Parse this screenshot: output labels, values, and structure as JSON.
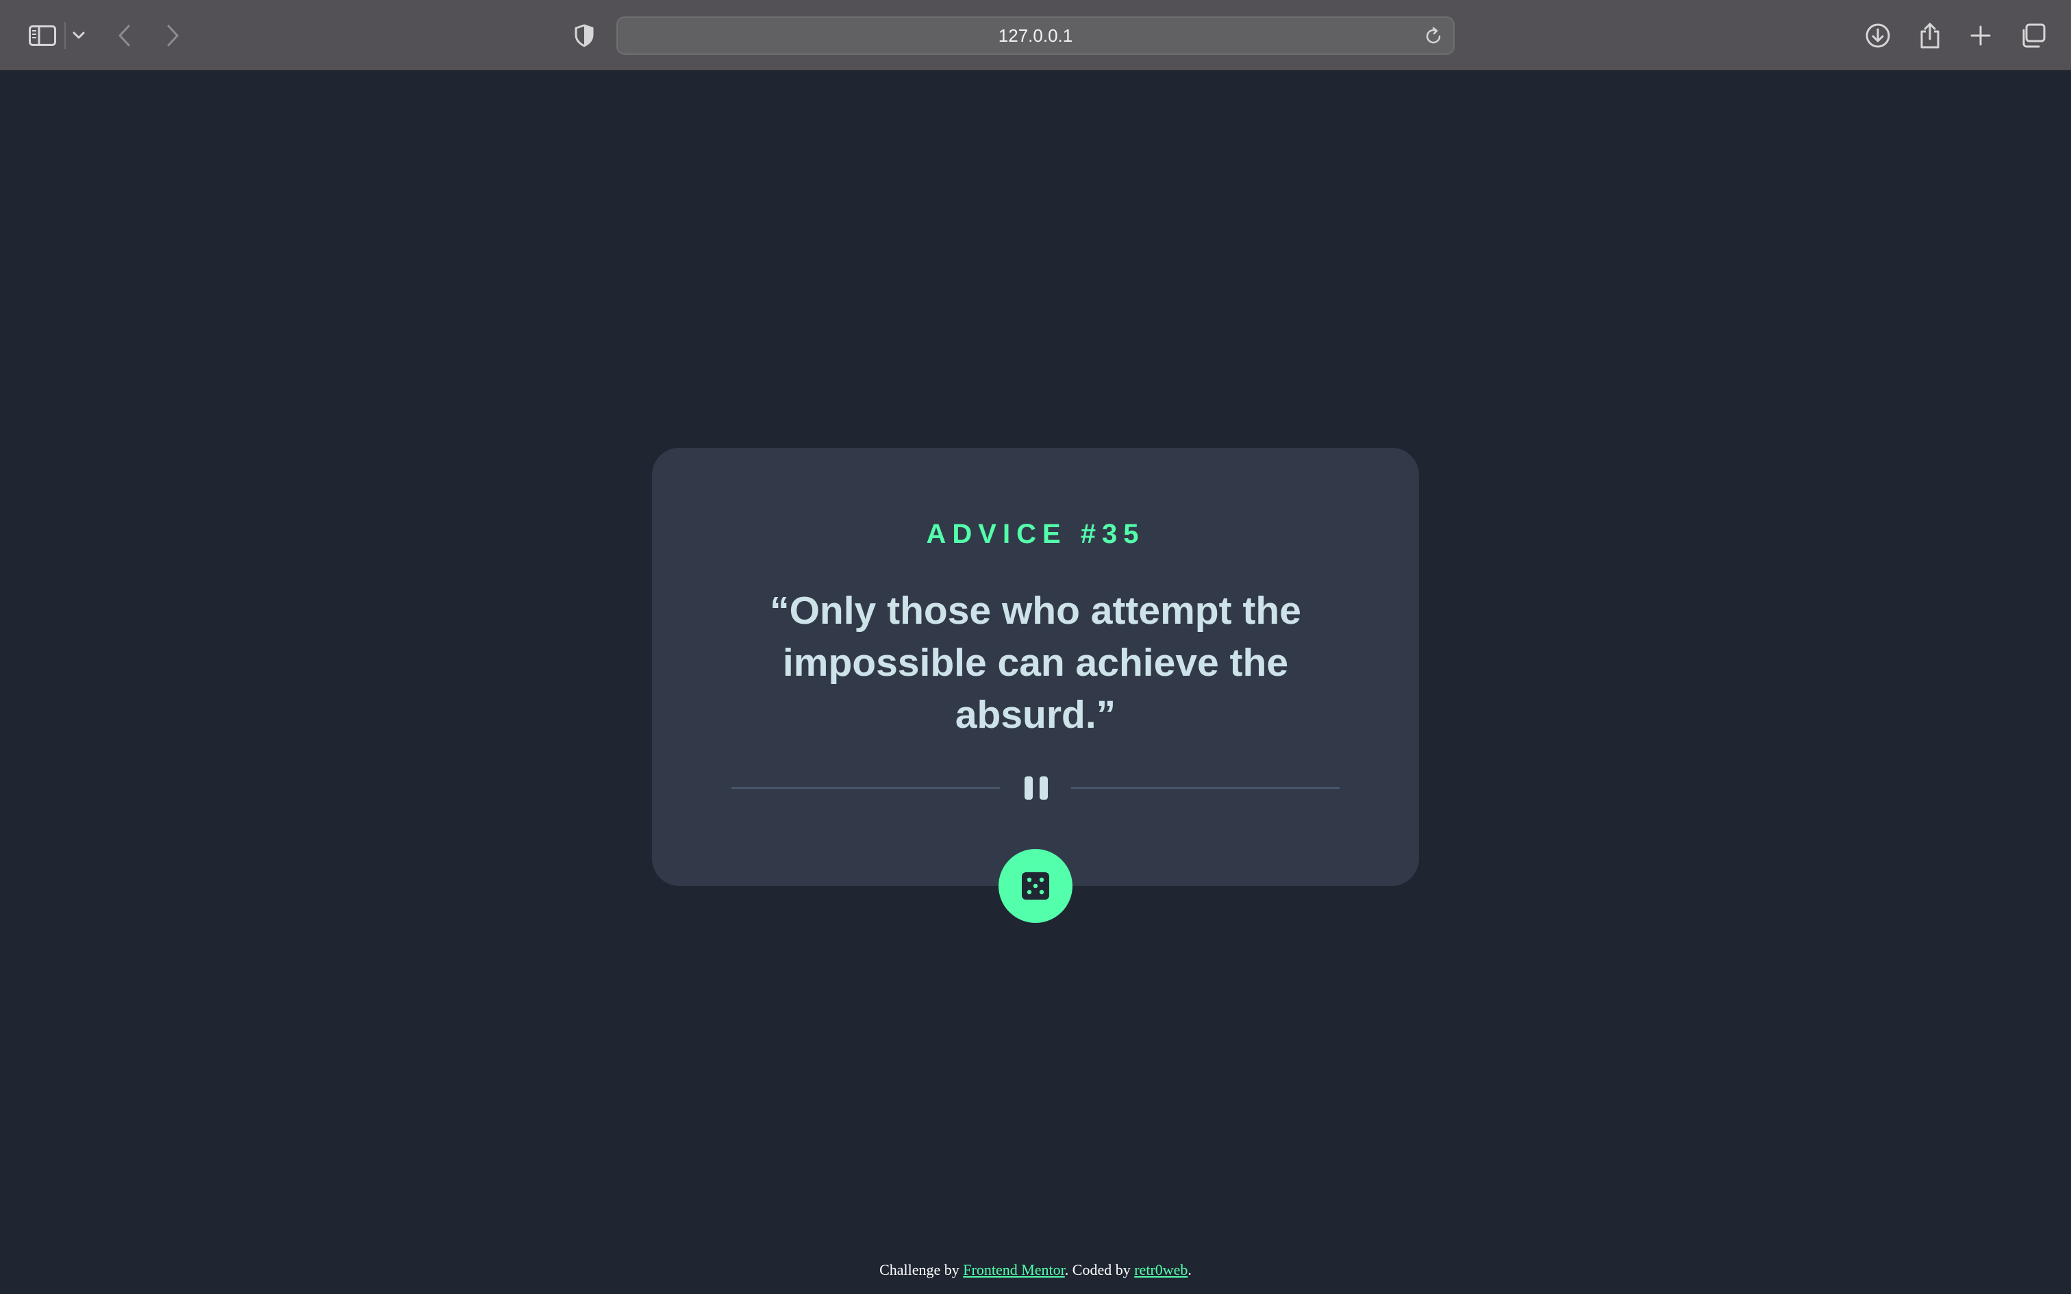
{
  "browser": {
    "url": "127.0.0.1",
    "icons": {
      "sidebar": "sidebar-icon",
      "sidebar_menu": "chevron-down-icon",
      "back": "chevron-left-icon",
      "forward": "chevron-right-icon",
      "privacy": "shield-icon",
      "reload": "reload-icon",
      "download": "download-icon",
      "share": "share-icon",
      "new_tab": "plus-icon",
      "tabs_overview": "tabs-icon"
    }
  },
  "card": {
    "title": "ADVICE #35",
    "quote": "“Only those who attempt the impossible can achieve the absurd.”",
    "divider_icon": "pause-icon",
    "button_icon": "dice-icon"
  },
  "footer": {
    "prefix": "Challenge by ",
    "link1": "Frontend Mentor",
    "middle": ". Coded by ",
    "link2": "retr0web",
    "suffix": "."
  },
  "colors": {
    "page_background": "#1f2632",
    "card_background": "#323a49",
    "accent": "#53ffaa",
    "quote_text": "#cee3e9"
  }
}
